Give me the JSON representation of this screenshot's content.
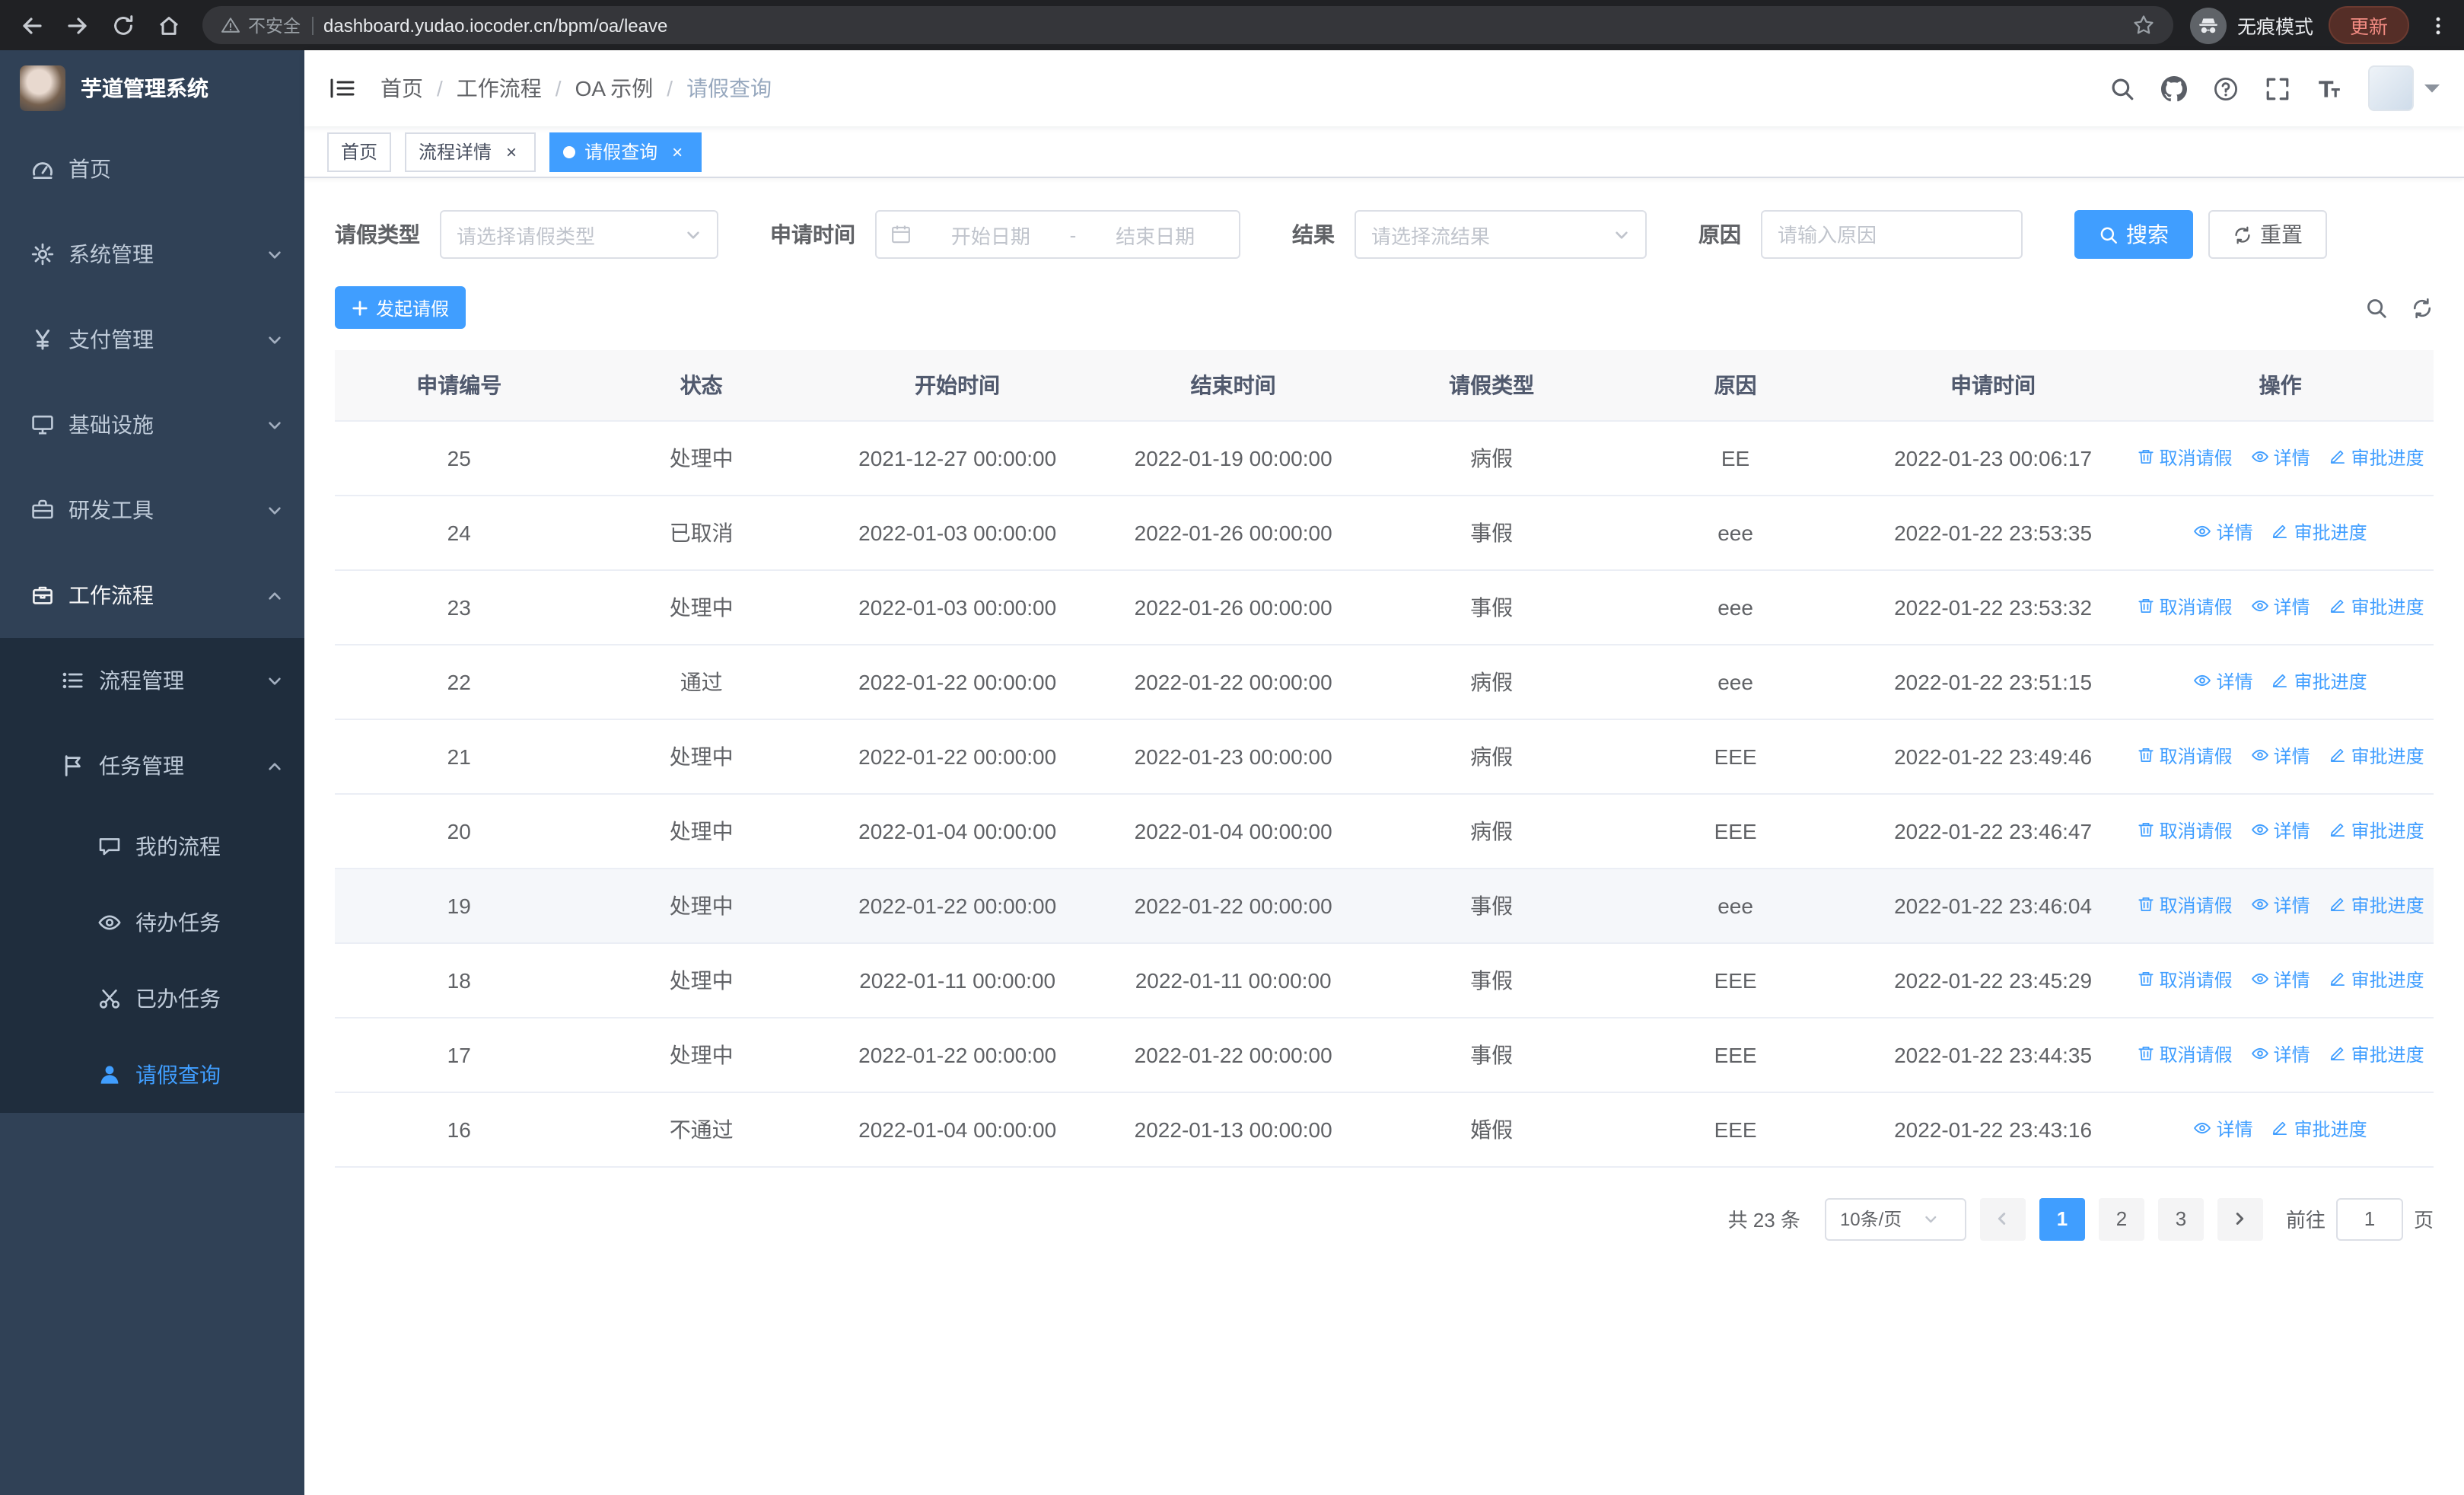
{
  "browser": {
    "security_warning": "不安全",
    "url": "dashboard.yudao.iocoder.cn/bpm/oa/leave",
    "incognito_label": "无痕模式",
    "update_label": "更新"
  },
  "sidebar": {
    "logo_title": "芋道管理系统",
    "menu": [
      {
        "key": "home",
        "label": "首页",
        "icon": "dashboard-icon",
        "level": 1
      },
      {
        "key": "system-management",
        "label": "系统管理",
        "icon": "gear-icon",
        "level": 1,
        "chevron": "down"
      },
      {
        "key": "payment-management",
        "label": "支付管理",
        "icon": "yen-icon",
        "level": 1,
        "chevron": "down"
      },
      {
        "key": "infrastructure",
        "label": "基础设施",
        "icon": "monitor-icon",
        "level": 1,
        "chevron": "down"
      },
      {
        "key": "dev-tools",
        "label": "研发工具",
        "icon": "toolbox-icon",
        "level": 1,
        "chevron": "down"
      },
      {
        "key": "workflow",
        "label": "工作流程",
        "icon": "briefcase-icon",
        "level": 1,
        "chevron": "up",
        "open": true
      },
      {
        "key": "process-management",
        "label": "流程管理",
        "icon": "list-icon",
        "level": 2,
        "chevron": "down",
        "sub": true
      },
      {
        "key": "task-management",
        "label": "任务管理",
        "icon": "flag-icon",
        "level": 2,
        "chevron": "up",
        "sub": true
      },
      {
        "key": "my-processes",
        "label": "我的流程",
        "icon": "chat-icon",
        "level": 3,
        "sub": true
      },
      {
        "key": "todo-tasks",
        "label": "待办任务",
        "icon": "eye-icon",
        "level": 3,
        "sub": true
      },
      {
        "key": "done-tasks",
        "label": "已办任务",
        "icon": "scissors-icon",
        "level": 3,
        "sub": true
      },
      {
        "key": "leave-query",
        "label": "请假查询",
        "icon": "user-icon",
        "level": 3,
        "sub": true,
        "active": true
      }
    ]
  },
  "header": {
    "breadcrumb": [
      "首页",
      "工作流程",
      "OA 示例",
      "请假查询"
    ]
  },
  "tabs": [
    {
      "key": "home",
      "label": "首页",
      "closable": false,
      "active": false
    },
    {
      "key": "process-detail",
      "label": "流程详情",
      "closable": true,
      "active": false
    },
    {
      "key": "leave-query",
      "label": "请假查询",
      "closable": true,
      "active": true
    }
  ],
  "filters": {
    "leave_type_label": "请假类型",
    "leave_type_placeholder": "请选择请假类型",
    "apply_time_label": "申请时间",
    "date_start_placeholder": "开始日期",
    "date_separator": "-",
    "date_end_placeholder": "结束日期",
    "result_label": "结果",
    "result_placeholder": "请选择流结果",
    "reason_label": "原因",
    "reason_placeholder": "请输入原因",
    "search_button": "搜索",
    "reset_button": "重置"
  },
  "toolbar": {
    "create_button": "发起请假"
  },
  "table": {
    "columns": [
      "申请编号",
      "状态",
      "开始时间",
      "结束时间",
      "请假类型",
      "原因",
      "申请时间",
      "操作"
    ],
    "actions": {
      "cancel": "取消请假",
      "detail": "详情",
      "progress": "审批进度"
    },
    "rows": [
      {
        "id": "25",
        "status": "处理中",
        "start": "2021-12-27 00:00:00",
        "end": "2022-01-19 00:00:00",
        "type": "病假",
        "reason": "EE",
        "applied": "2022-01-23 00:06:17",
        "cancellable": true
      },
      {
        "id": "24",
        "status": "已取消",
        "start": "2022-01-03 00:00:00",
        "end": "2022-01-26 00:00:00",
        "type": "事假",
        "reason": "eee",
        "applied": "2022-01-22 23:53:35",
        "cancellable": false
      },
      {
        "id": "23",
        "status": "处理中",
        "start": "2022-01-03 00:00:00",
        "end": "2022-01-26 00:00:00",
        "type": "事假",
        "reason": "eee",
        "applied": "2022-01-22 23:53:32",
        "cancellable": true
      },
      {
        "id": "22",
        "status": "通过",
        "start": "2022-01-22 00:00:00",
        "end": "2022-01-22 00:00:00",
        "type": "病假",
        "reason": "eee",
        "applied": "2022-01-22 23:51:15",
        "cancellable": false
      },
      {
        "id": "21",
        "status": "处理中",
        "start": "2022-01-22 00:00:00",
        "end": "2022-01-23 00:00:00",
        "type": "病假",
        "reason": "EEE",
        "applied": "2022-01-22 23:49:46",
        "cancellable": true
      },
      {
        "id": "20",
        "status": "处理中",
        "start": "2022-01-04 00:00:00",
        "end": "2022-01-04 00:00:00",
        "type": "病假",
        "reason": "EEE",
        "applied": "2022-01-22 23:46:47",
        "cancellable": true
      },
      {
        "id": "19",
        "status": "处理中",
        "start": "2022-01-22 00:00:00",
        "end": "2022-01-22 00:00:00",
        "type": "事假",
        "reason": "eee",
        "applied": "2022-01-22 23:46:04",
        "cancellable": true,
        "highlighted": true
      },
      {
        "id": "18",
        "status": "处理中",
        "start": "2022-01-11 00:00:00",
        "end": "2022-01-11 00:00:00",
        "type": "事假",
        "reason": "EEE",
        "applied": "2022-01-22 23:45:29",
        "cancellable": true
      },
      {
        "id": "17",
        "status": "处理中",
        "start": "2022-01-22 00:00:00",
        "end": "2022-01-22 00:00:00",
        "type": "事假",
        "reason": "EEE",
        "applied": "2022-01-22 23:44:35",
        "cancellable": true
      },
      {
        "id": "16",
        "status": "不通过",
        "start": "2022-01-04 00:00:00",
        "end": "2022-01-13 00:00:00",
        "type": "婚假",
        "reason": "EEE",
        "applied": "2022-01-22 23:43:16",
        "cancellable": false
      }
    ]
  },
  "pagination": {
    "total": "共 23 条",
    "page_size": "10条/页",
    "pages": [
      "1",
      "2",
      "3"
    ],
    "active_page": "1",
    "goto_label": "前往",
    "goto_value": "1",
    "goto_unit": "页"
  }
}
